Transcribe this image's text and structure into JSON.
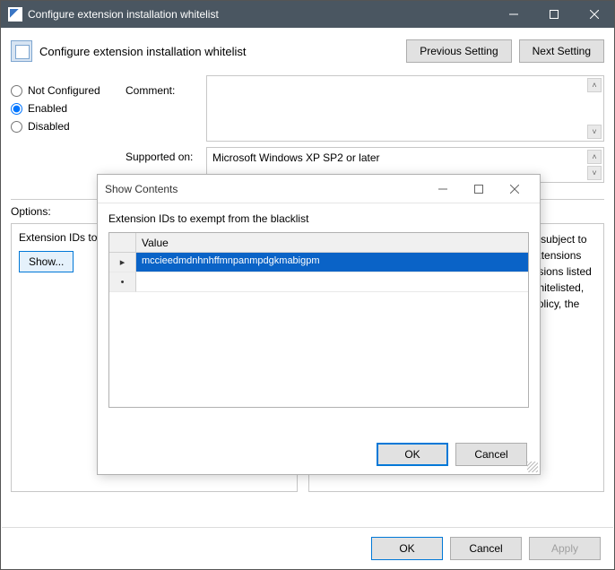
{
  "window": {
    "title": "Configure extension installation whitelist",
    "header": "Configure extension installation whitelist",
    "previous_setting": "Previous Setting",
    "next_setting": "Next Setting"
  },
  "radios": {
    "not_configured": "Not Configured",
    "enabled": "Enabled",
    "disabled": "Disabled",
    "selected": "enabled"
  },
  "labels": {
    "comment": "Comment:",
    "supported_on": "Supported on:",
    "options": "Options:"
  },
  "supported_on_value": "Microsoft Windows XP SP2 or later",
  "left_panel": {
    "caption": "Extension IDs to exempt from the blacklist",
    "show_button": "Show..."
  },
  "help_text": "Allows you to specify which extensions are not subject to the blacklist.\n\nA blacklist value of '*' means all extensions are blacklisted and users can only install extensions listed in the whitelist.\n\nBy default, all extensions are whitelisted, but if all extensions have been blacklisted by policy, the whitelist can be used to override that policy.",
  "footer": {
    "ok": "OK",
    "cancel": "Cancel",
    "apply": "Apply"
  },
  "dialog": {
    "title": "Show Contents",
    "caption": "Extension IDs to exempt from the blacklist",
    "column": "Value",
    "rows": [
      {
        "marker": "▸",
        "value": "mccieedmdnhnhffmnpanmpdgkmabigpm",
        "selected": true
      },
      {
        "marker": "•",
        "value": "",
        "selected": false
      }
    ],
    "ok": "OK",
    "cancel": "Cancel"
  }
}
